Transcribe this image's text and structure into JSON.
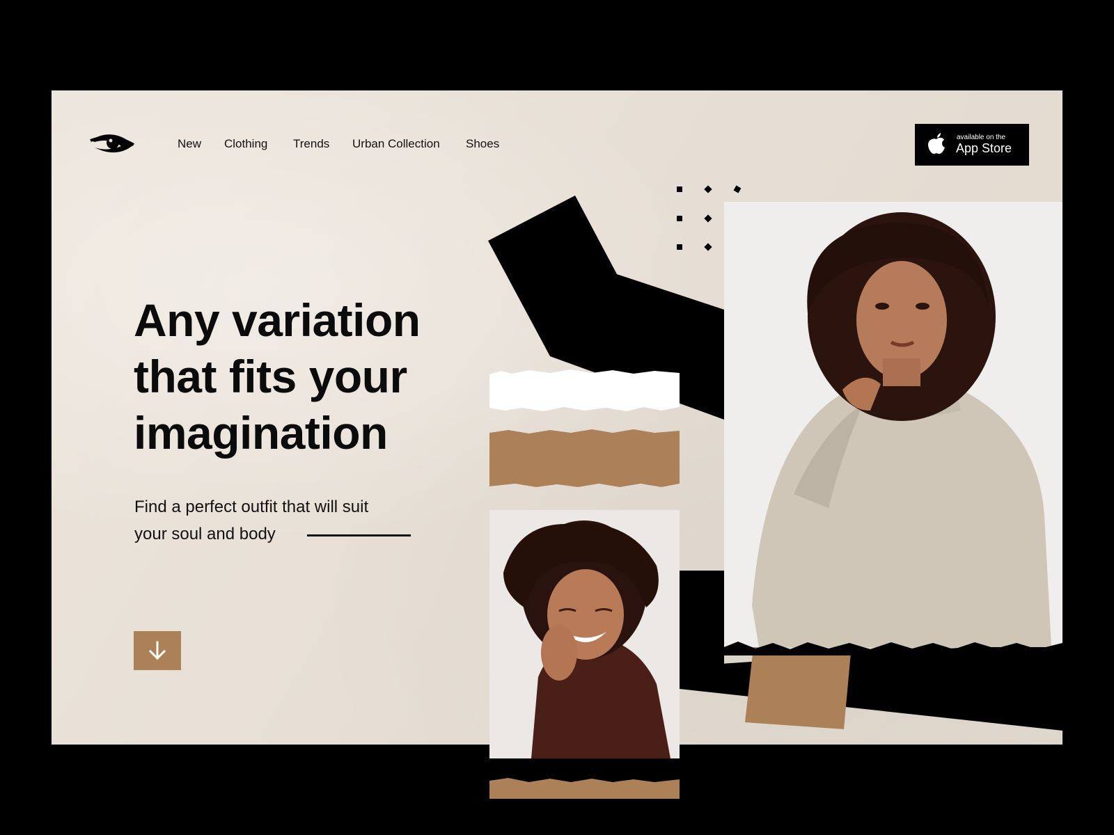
{
  "nav": {
    "logo_icon": "eye-icon",
    "links": [
      "New",
      "Clothing",
      "Trends",
      "Urban Collection",
      "Shoes"
    ]
  },
  "app_store": {
    "small": "available on the",
    "big": "App Store",
    "icon": "apple-icon"
  },
  "hero": {
    "headline_lines": [
      "Any variation",
      "that fits your",
      "imagination"
    ],
    "sub_line1": "Find a perfect outfit that will suit",
    "sub_line2": "your soul and body",
    "scroll_icon": "arrow-down-icon"
  },
  "colors": {
    "background": "#e8dfd4",
    "accent": "#ad8157",
    "dark": "#000000"
  }
}
